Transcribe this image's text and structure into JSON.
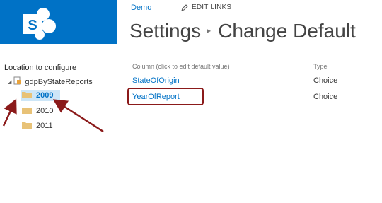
{
  "header": {
    "site_link": "Demo",
    "edit_links_label": "EDIT LINKS",
    "title": "Settings",
    "title_sub": "Change Default"
  },
  "tree": {
    "heading": "Location to configure",
    "root": "gdpByStateReports",
    "folders": [
      "2009",
      "2010",
      "2011"
    ],
    "selected_folder": "2009"
  },
  "columns": {
    "header_column": "Column (click to edit default value)",
    "header_type": "Type",
    "rows": [
      {
        "name": "StateOfOrigin",
        "type": "Choice"
      },
      {
        "name": "YearOfReport",
        "type": "Choice"
      }
    ]
  },
  "colors": {
    "brand": "#0072c6",
    "annotation": "#8b1a1a",
    "folder": "#e8c277"
  },
  "icons": {
    "logo": "sharepoint-logo-icon",
    "edit": "pencil-icon",
    "library": "document-library-icon",
    "folder": "folder-icon"
  }
}
